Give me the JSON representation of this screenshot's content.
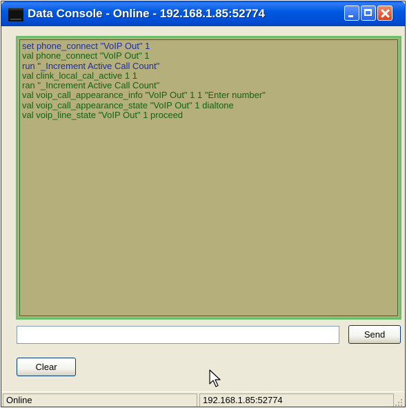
{
  "window": {
    "title": "Data Console - Online - 192.168.1.85:52774",
    "title_bar_color": "#0055e5",
    "buttons": {
      "minimize_icon": "minimize-icon",
      "maximize_icon": "maximize-icon",
      "close_icon": "close-icon"
    }
  },
  "console": {
    "background": "#b5af7c",
    "border_color": "#6cc06c",
    "sent_color": "#1c2ea0",
    "received_color": "#126312",
    "lines": [
      {
        "text": "set phone_connect \"VoIP Out\" 1",
        "kind": "sent"
      },
      {
        "text": "val phone_connect \"VoIP Out\" 1",
        "kind": "recv"
      },
      {
        "text": "run \"_Increment Active Call Count\"",
        "kind": "sent"
      },
      {
        "text": "val clink_local_cal_active 1 1",
        "kind": "recv"
      },
      {
        "text": "ran \"_Increment Active Call Count\"",
        "kind": "recv"
      },
      {
        "text": "val voip_call_appearance_info \"VoIP Out\" 1 1 \"Enter number\"",
        "kind": "recv"
      },
      {
        "text": "val voip_call_appearance_state \"VoIP Out\" 1 dialtone",
        "kind": "recv"
      },
      {
        "text": "val voip_line_state \"VoIP Out\" 1 proceed",
        "kind": "recv"
      }
    ]
  },
  "command": {
    "value": "",
    "placeholder": ""
  },
  "actions": {
    "send_label": "Send",
    "clear_label": "Clear"
  },
  "statusbar": {
    "state": "Online",
    "address": "192.168.1.85:52774"
  }
}
